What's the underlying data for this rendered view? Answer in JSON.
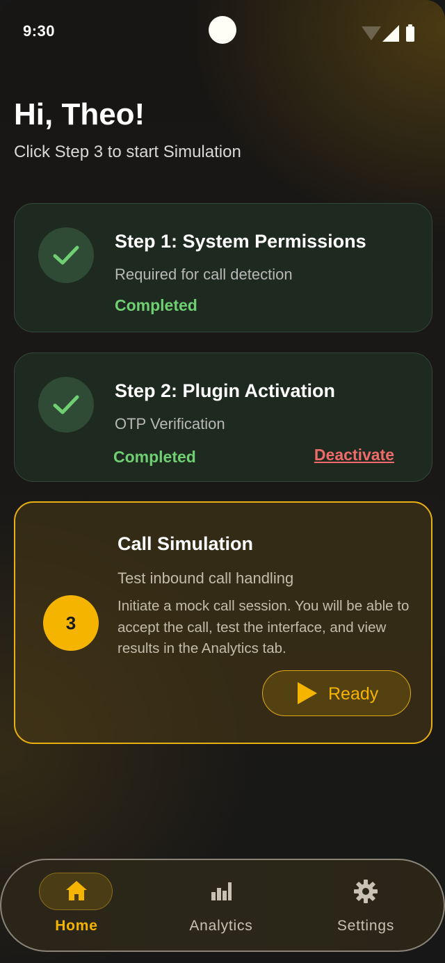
{
  "status_bar": {
    "time": "9:30"
  },
  "greeting": "Hi, Theo!",
  "subtitle": "Click Step 3 to start Simulation",
  "steps": [
    {
      "title": "Step 1: System Permissions",
      "description": "Required for call detection",
      "status": "Completed"
    },
    {
      "title": "Step 2: Plugin Activation",
      "description": "OTP Verification",
      "status": "Completed",
      "action": "Deactivate"
    }
  ],
  "simulation": {
    "number": "3",
    "title": "Call Simulation",
    "subtitle": "Test inbound call handling",
    "body": "Initiate a mock call session. You will be able to accept the call, test the interface, and view results in the Analytics tab.",
    "button": "Ready"
  },
  "nav": {
    "home": "Home",
    "analytics": "Analytics",
    "settings": "Settings",
    "active": "home"
  },
  "colors": {
    "accent": "#f4b400",
    "success": "#6fcf72",
    "danger": "#ef6b6b"
  }
}
